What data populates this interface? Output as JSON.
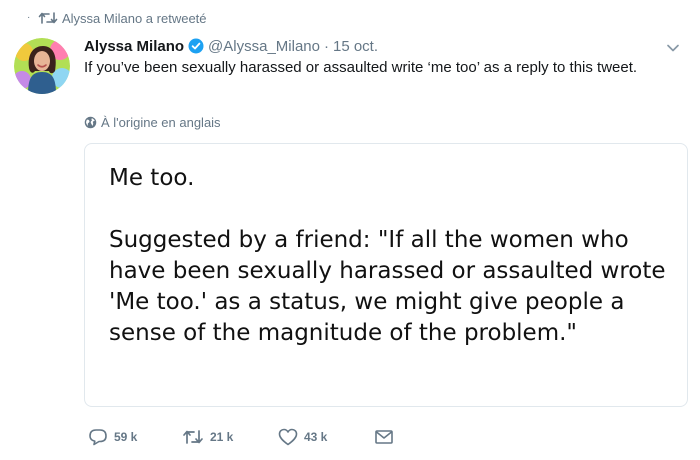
{
  "retweet": {
    "label": "Alyssa Milano a retweeté",
    "dot": "·",
    "icon": "retweet-icon"
  },
  "author": {
    "name": "Alyssa Milano",
    "handle": "@Alyssa_Milano",
    "separator": "·",
    "date": "15 oct.",
    "verified_icon": "verified-badge-icon"
  },
  "tweet": {
    "text": "If you’ve been sexually harassed or assaulted write ‘me too’ as a reply to this tweet.",
    "translation_label": "À l'origine en anglais"
  },
  "card": {
    "line1": "Me too.",
    "paragraph": "Suggested by a friend: \"If all the women who have been sexually harassed or assaulted wrote 'Me too.' as a status, we might give people a sense of the magnitude of the problem.\""
  },
  "actions": {
    "replies": "59 k",
    "retweets": "21 k",
    "likes": "43 k",
    "icons": [
      "reply-icon",
      "retweet-icon",
      "like-icon",
      "direct-message-icon"
    ]
  },
  "colors": {
    "muted": "#657786",
    "verified": "#1da1f2",
    "text": "#14171a",
    "border": "#e1e8ed"
  }
}
